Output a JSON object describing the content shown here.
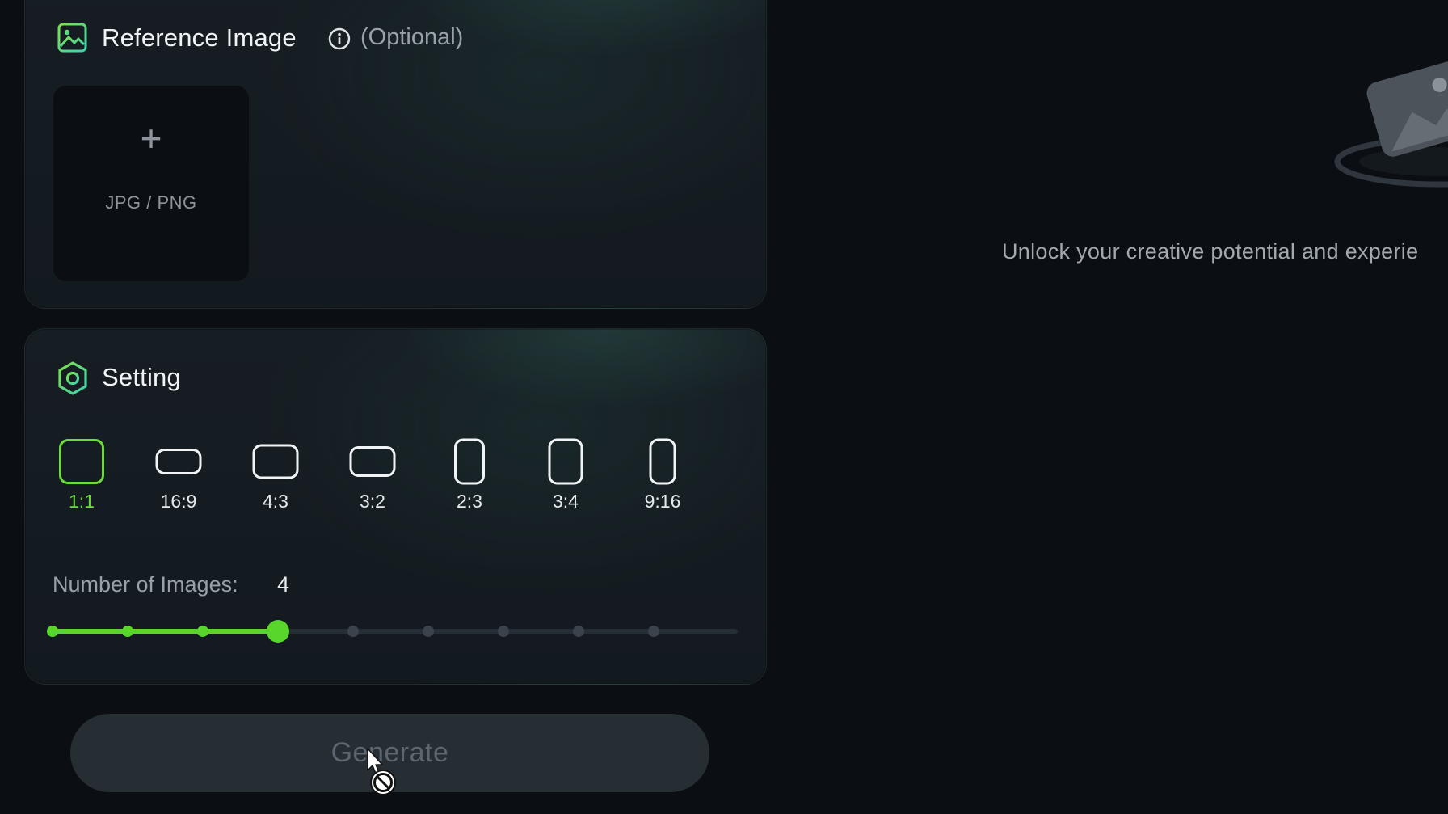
{
  "reference_image": {
    "title": "Reference Image",
    "optional_label": "(Optional)",
    "upload_plus": "+",
    "upload_label": "JPG / PNG",
    "icons": [
      "image-icon",
      "info-icon"
    ]
  },
  "setting": {
    "title": "Setting",
    "icon": "settings-hexagon-icon",
    "ratios": [
      {
        "label": "1:1",
        "active": true
      },
      {
        "label": "16:9",
        "active": false
      },
      {
        "label": "4:3",
        "active": false
      },
      {
        "label": "3:2",
        "active": false
      },
      {
        "label": "2:3",
        "active": false
      },
      {
        "label": "3:4",
        "active": false
      },
      {
        "label": "9:16",
        "active": false
      }
    ],
    "number_of_images_label": "Number of Images:",
    "number_of_images_value": "4",
    "slider": {
      "min": 1,
      "max": 9,
      "value": 4
    }
  },
  "generate_label": "Generate",
  "tagline": "Unlock your creative potential and experie",
  "colors": {
    "accent": "#58d62c",
    "accent_text": "#6bdc3c",
    "background": "#0b0e12",
    "card": "#151c21",
    "button": "#262d33"
  }
}
